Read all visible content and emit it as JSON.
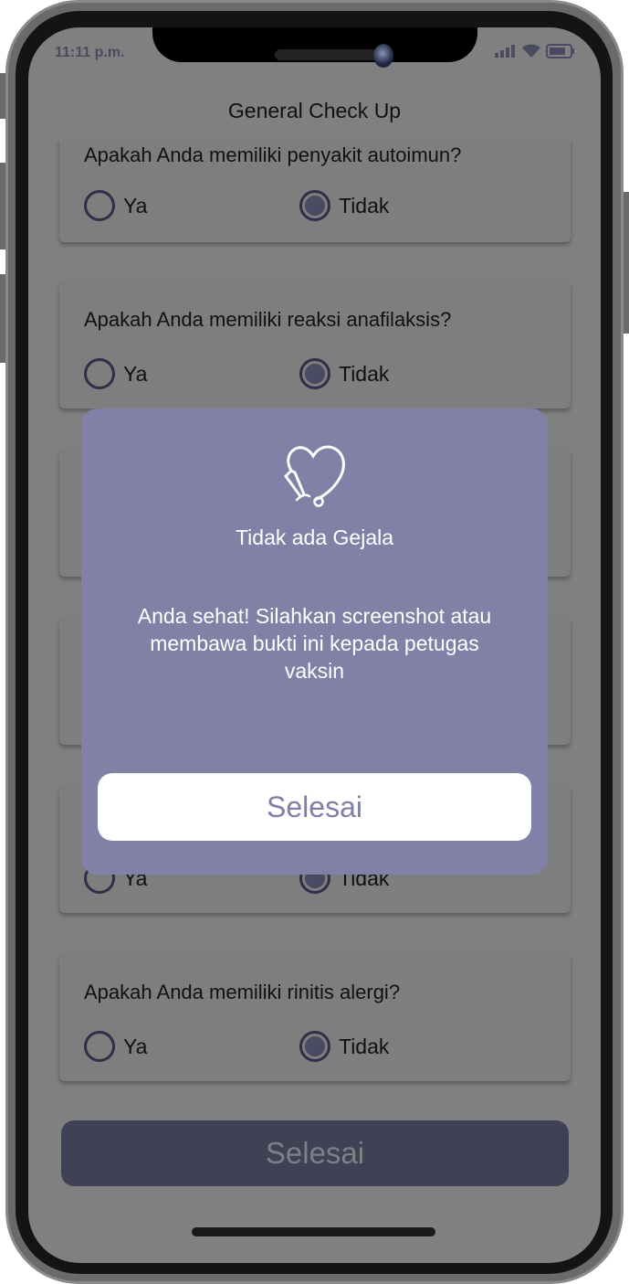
{
  "status_bar": {
    "time": "11:11 p.m."
  },
  "header": {
    "title": "General Check Up"
  },
  "questions": [
    {
      "text": "Apakah Anda memiliki penyakit autoimun?",
      "options": [
        "Ya",
        "Tidak"
      ],
      "selected": "Tidak"
    },
    {
      "text": "Apakah Anda memiliki reaksi anafilaksis?",
      "options": [
        "Ya",
        "Tidak"
      ],
      "selected": "Tidak"
    },
    {
      "text": "",
      "options": [],
      "selected": null
    },
    {
      "text": "",
      "options": [],
      "selected": null
    },
    {
      "text": "",
      "options": [
        "Ya",
        "Tidak"
      ],
      "selected": "Tidak"
    },
    {
      "text": "Apakah Anda memiliki rinitis alergi?",
      "options": [
        "Ya",
        "Tidak"
      ],
      "selected": "Tidak"
    }
  ],
  "submit_label": "Selesai",
  "dialog": {
    "icon": "heart-stethoscope-icon",
    "title": "Tidak ada Gejala",
    "message": "Anda sehat! Silahkan screenshot atau membawa bukti ini kepada petugas vaksin",
    "button_label": "Selesai"
  },
  "colors": {
    "dialog": "#8181a7",
    "submit_button": "#414155",
    "radio": "#2f2f48"
  }
}
